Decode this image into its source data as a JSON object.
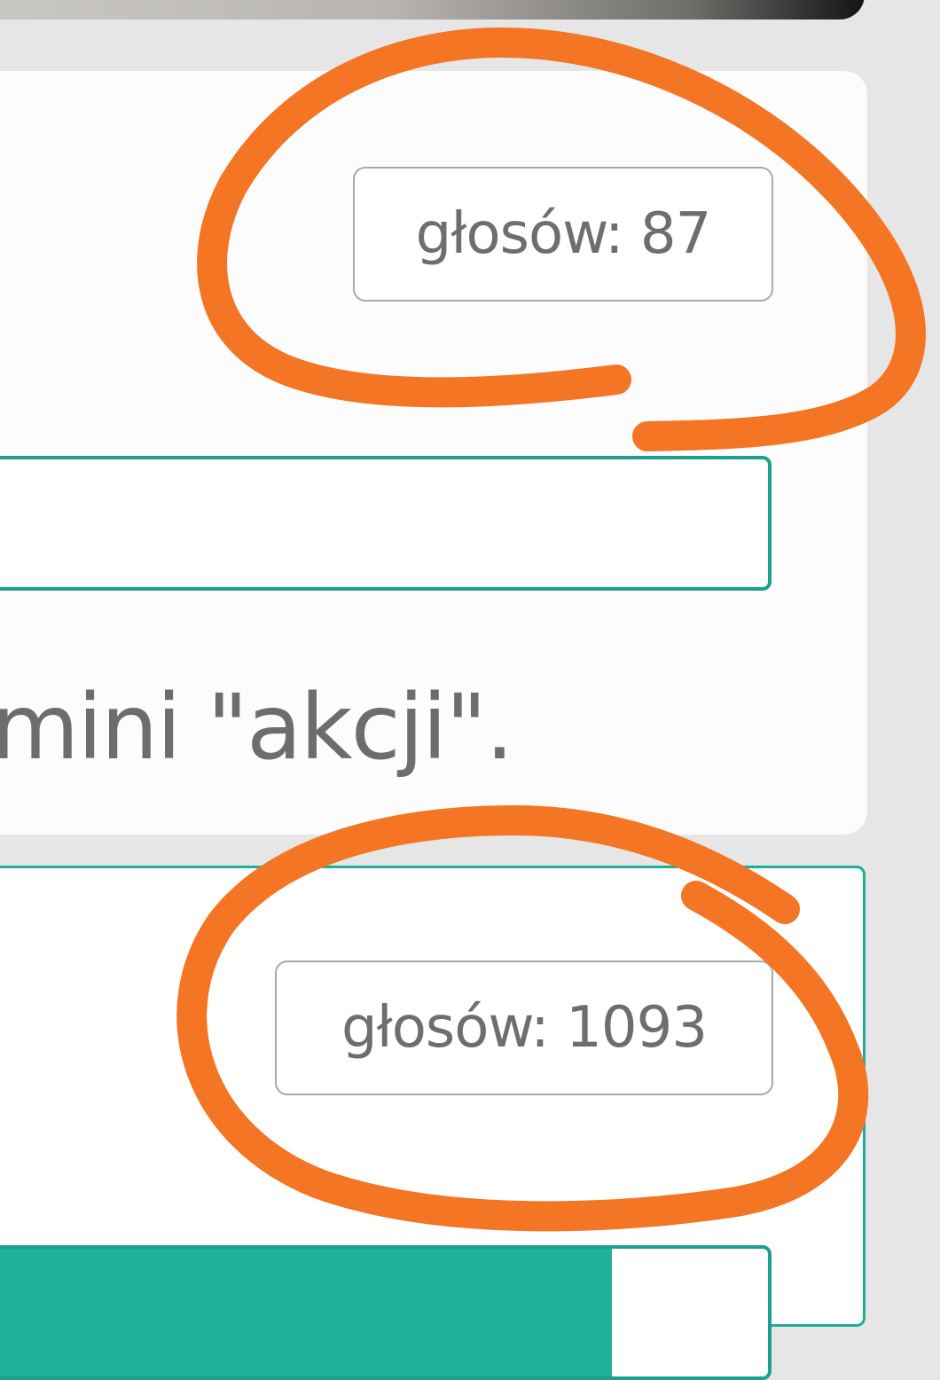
{
  "poll_option_1": {
    "votes_label": "głosów: 87",
    "vote_share": 0
  },
  "poll_option_2": {
    "votes_label": "głosów: 1093",
    "vote_share": 0.8
  },
  "description_text": "mini \"akcji\".",
  "colors": {
    "accent": "#1fad99",
    "annotation": "#f47524",
    "badge_text": "#6e6e6e"
  }
}
